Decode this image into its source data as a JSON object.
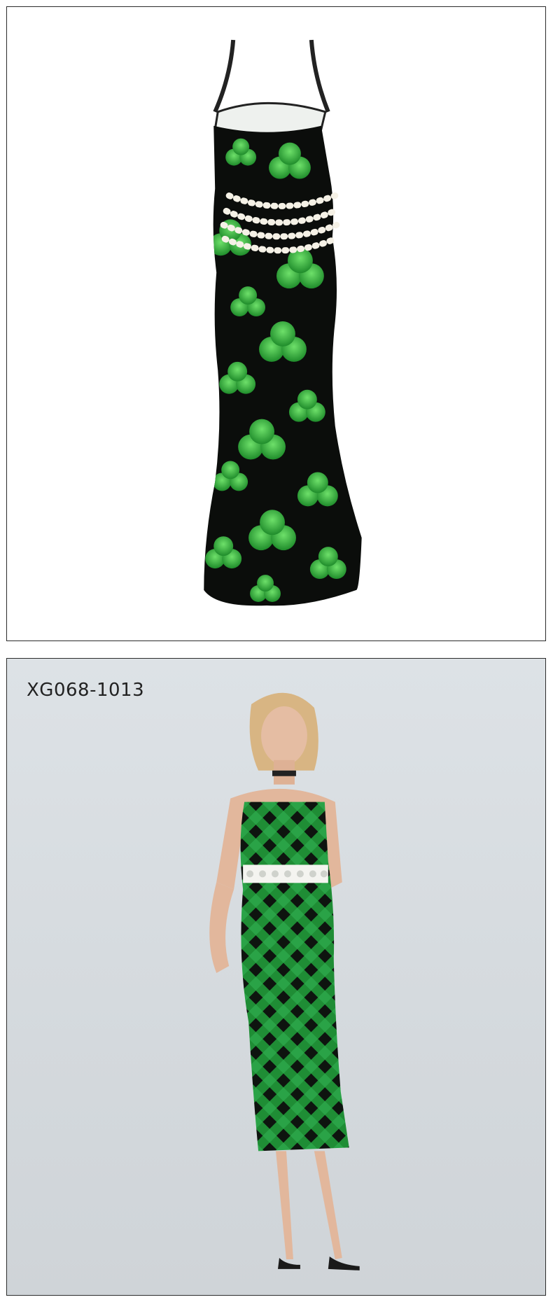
{
  "top_image": {
    "description_icon": "dress-back-view-image",
    "colors": {
      "background": "#ffffff",
      "dress_base": "#0b0d0b",
      "clover": "#2fae3a",
      "pearl": "#f5f1e6"
    }
  },
  "bottom_image": {
    "sku": "XG068-1013",
    "colors": {
      "background": "#d9dee2",
      "plaid_green": "#1f8d35",
      "plaid_dark": "#0e140f",
      "skin": "#e2b79c"
    }
  }
}
